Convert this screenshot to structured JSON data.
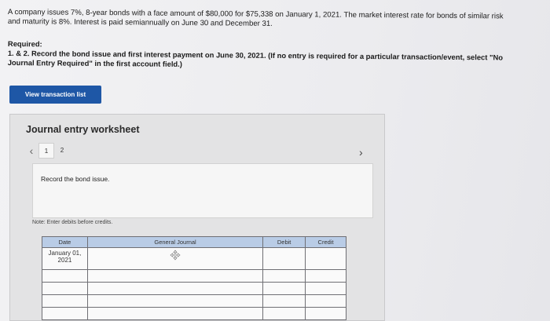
{
  "problem": {
    "text": "A company issues 7%, 8-year bonds with a face amount of $80,000 for $75,338 on January 1, 2021. The market interest rate for bonds of similar risk and maturity is 8%. Interest is paid semiannually on June 30 and December 31."
  },
  "required": {
    "title": "Required:",
    "line1": "1. & 2. Record the bond issue and first interest payment on June 30, 2021.",
    "line1_bold": "(If no entry is required for a particular transaction/event, select \"No Journal Entry Required\" in the first account field.)"
  },
  "view_button": {
    "label": "View transaction list"
  },
  "worksheet": {
    "title": "Journal entry worksheet",
    "pages": [
      "1",
      "2"
    ],
    "current_page": "1",
    "description": "Record the bond issue.",
    "note": "Note: Enter debits before credits."
  },
  "table": {
    "headers": {
      "date": "Date",
      "account": "General Journal",
      "debit": "Debit",
      "credit": "Credit"
    },
    "first_row_date": "January 01, 2021"
  },
  "icons": {
    "prev": "chevron-left-icon",
    "next": "chevron-right-icon",
    "move": "move-icon"
  },
  "colors": {
    "button": "#1e57a6",
    "header": "#b9cce6"
  }
}
